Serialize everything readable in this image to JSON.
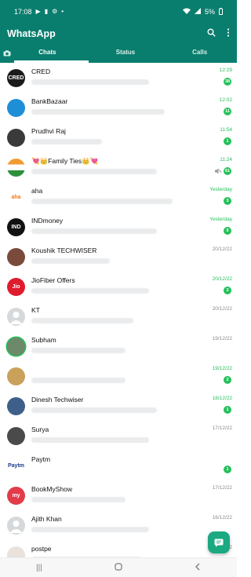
{
  "status_bar": {
    "time": "17:08",
    "battery": "5%"
  },
  "app": {
    "title": "WhatsApp"
  },
  "tabs": [
    {
      "label": "Chats",
      "badge": "",
      "active": true
    },
    {
      "label": "Status",
      "active": false
    },
    {
      "label": "Calls",
      "active": false
    }
  ],
  "chats": [
    {
      "name": "CRED",
      "time": "12:29",
      "unread": "38",
      "avatar_text": "CRED"
    },
    {
      "name": "BankBazaar",
      "time": "12:02",
      "unread": "11",
      "avatar_text": ""
    },
    {
      "name": "Prudhvi Raj",
      "time": "11:54",
      "unread": "1",
      "avatar_text": ""
    },
    {
      "name": "💘👑Family Ties👑💘",
      "time": "11:24",
      "unread": "61",
      "avatar_text": ""
    },
    {
      "name": "aha",
      "time": "Yesterday",
      "unread": "3",
      "avatar_text": "aha"
    },
    {
      "name": "INDmoney",
      "time": "Yesterday",
      "unread": "9",
      "avatar_text": "IND"
    },
    {
      "name": "Koushik TECHWISER",
      "time": "20/12/22",
      "unread": "",
      "avatar_text": ""
    },
    {
      "name": "JioFiber Offers",
      "time": "20/12/22",
      "unread": "2",
      "avatar_text": "Jio"
    },
    {
      "name": "KT",
      "time": "20/12/22",
      "unread": "",
      "avatar_text": ""
    },
    {
      "name": "Subham",
      "time": "19/12/22",
      "unread": "",
      "avatar_text": ""
    },
    {
      "name": "",
      "time": "19/12/22",
      "unread": "2",
      "avatar_text": ""
    },
    {
      "name": "Dinesh Techwiser",
      "time": "18/12/22",
      "unread": "1",
      "avatar_text": ""
    },
    {
      "name": "Surya",
      "time": "17/12/22",
      "unread": "",
      "avatar_text": ""
    },
    {
      "name": "Paytm",
      "time": "",
      "unread": "1",
      "avatar_text": "Paytm"
    },
    {
      "name": "BookMyShow",
      "time": "17/12/22",
      "unread": "",
      "avatar_text": "my"
    },
    {
      "name": "Ajith Khan",
      "time": "16/12/22",
      "unread": "",
      "avatar_text": ""
    },
    {
      "name": "postpe",
      "time": "16/12/22",
      "unread": "",
      "avatar_text": ""
    }
  ],
  "colors": {
    "brand": "#0a7e6e",
    "unread": "#25c05a",
    "fab": "#1aa980"
  }
}
